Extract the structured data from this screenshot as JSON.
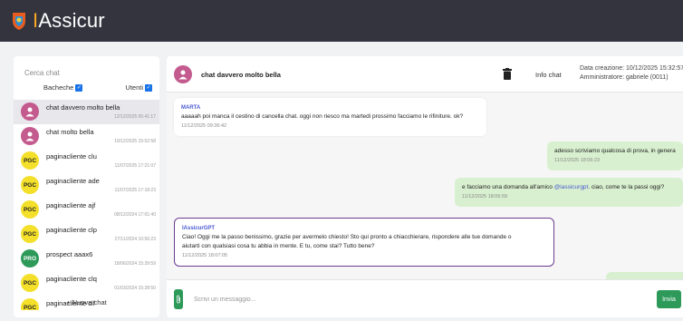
{
  "app": {
    "brand_prefix": "I",
    "brand_rest": "Assicur"
  },
  "colors": {
    "header": "#34343f",
    "accent": "#f5a623",
    "green": "#2e9a5a",
    "bot_border": "#6e3a8f",
    "out_bubble": "#d8f0cf"
  },
  "sidebar": {
    "search_placeholder": "Cerca chat",
    "filter_boards": "Bacheche",
    "filter_users": "Utenti",
    "new_chat_label": "+ Nuova chat",
    "chats": [
      {
        "title": "chat davvero molto bella",
        "time": "12/12/2025 05:41:17",
        "avatar": "person-icon"
      },
      {
        "title": "chat molto bella",
        "time": "10/12/2025 15:52:58",
        "avatar": "person-icon"
      },
      {
        "title": "paginacliente clu",
        "time": "11/07/2025 17:21:07",
        "avatar_text": "PGC"
      },
      {
        "title": "paginacliente ade",
        "time": "11/07/2025 17:18:23",
        "avatar_text": "PGC"
      },
      {
        "title": "paginacliente ajf",
        "time": "08/12/2024 17:01:40",
        "avatar_text": "PGC"
      },
      {
        "title": "paginacliente clp",
        "time": "27/11/2024 10:56:23",
        "avatar_text": "PGC"
      },
      {
        "title": "prospect aaax6",
        "time": "18/06/2024 15:39:59",
        "avatar_text": "PRO"
      },
      {
        "title": "paginacliente clq",
        "time": "01/03/2024 15:28:50",
        "avatar_text": "PGC"
      },
      {
        "title": "paginacliente clf",
        "time": "",
        "avatar_text": "PGC"
      }
    ]
  },
  "chat": {
    "title": "chat davvero molto bella",
    "info_label": "Info chat",
    "creation_date": "Data creazione: 10/12/2025 15:32:57",
    "admin": "Amministratore: gabriele (0011)",
    "messages": [
      {
        "sender": "MARTA",
        "text": "aaaaah poi manca il cestino di cancella chat. oggi non riesco ma martedi prossimo facciamo le rifiniture. ok?",
        "time": "11/12/2025 09:36:42"
      },
      {
        "text": "adesso scriviamo qualcosa di prova, in generale...",
        "time": "11/12/2025 18:06:23"
      },
      {
        "text_before": "e facciamo una domanda all'amico ",
        "mention": "@iassicurgpt",
        "text_after": ". ciao, come te la passi oggi?",
        "time": "11/12/2025 18:06:59"
      },
      {
        "sender": "IAssicurGPT",
        "line1": "Ciao! Oggi me la passo benissimo, grazie per avermelo chiesto! Sto qui pronto a chiacchierare, rispondere alle tue domande o",
        "line2": "aiutarti con qualsiasi cosa tu abbia in mente. E tu, come stai? Tutto bene?",
        "time": "11/12/2025 18:07:05"
      }
    ]
  },
  "composer": {
    "placeholder": "Scrivi un messaggio...",
    "send_label": "Invia",
    "attach_icon": "paperclip-icon"
  }
}
